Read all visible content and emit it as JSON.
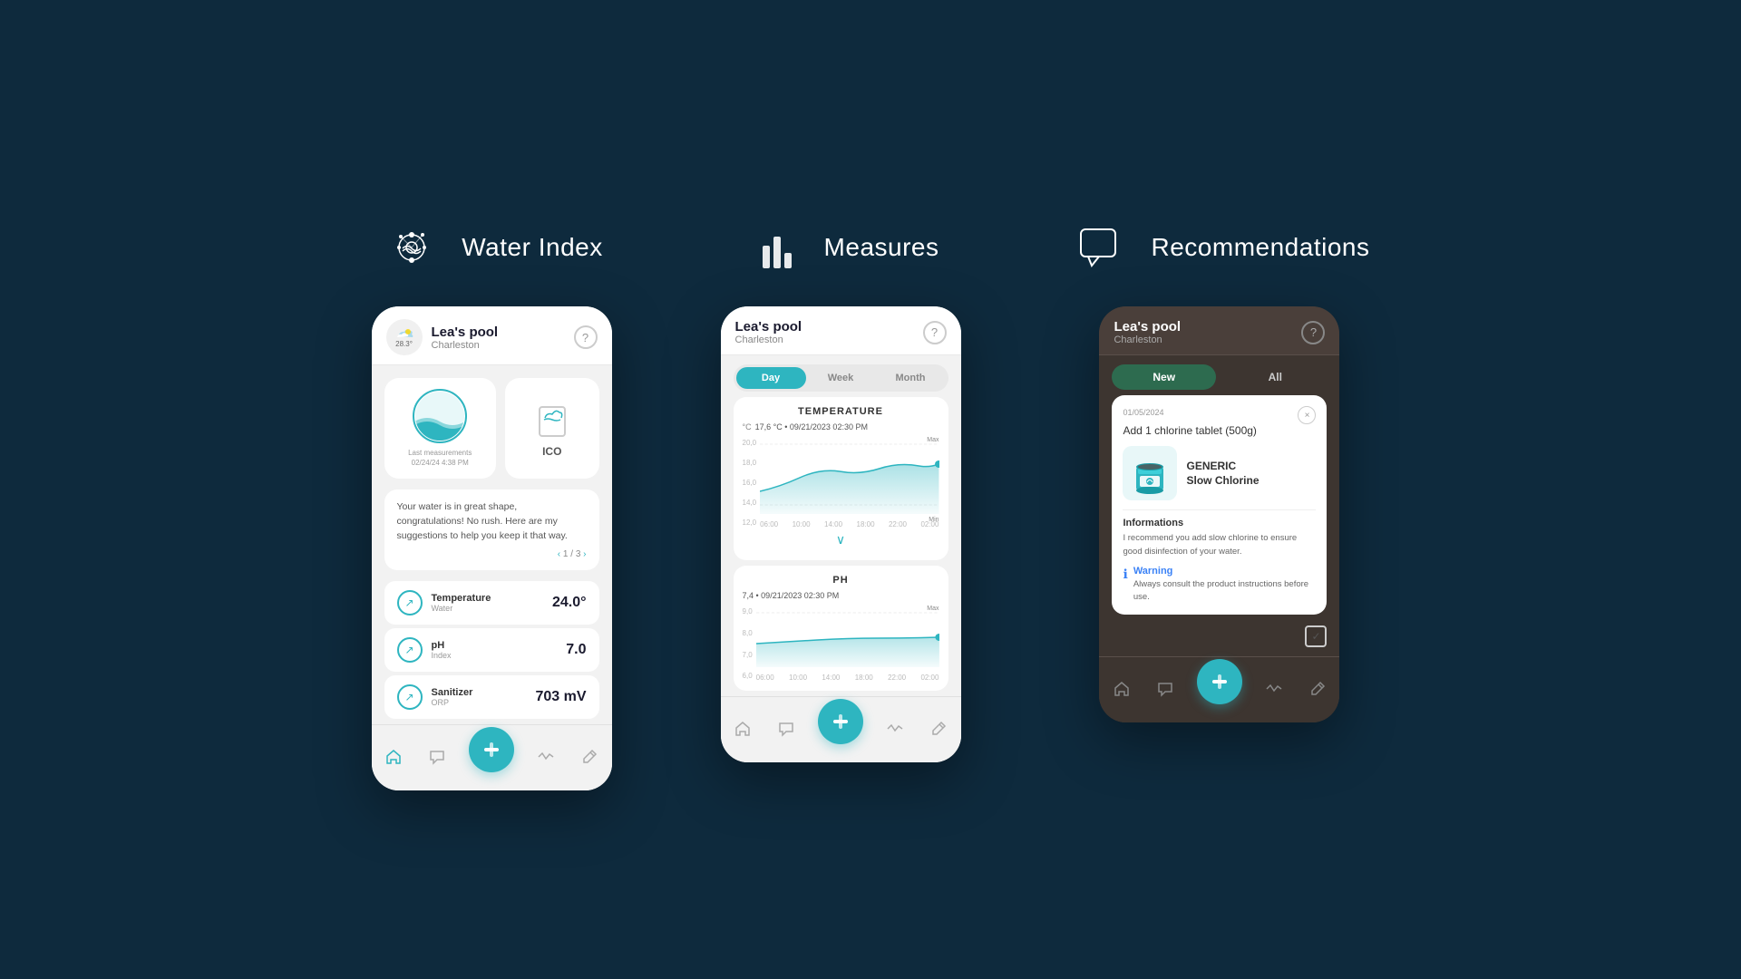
{
  "sections": [
    {
      "id": "water-index",
      "icon": "water-index-icon",
      "title": "Water Index"
    },
    {
      "id": "measures",
      "icon": "measures-icon",
      "title": "Measures"
    },
    {
      "id": "recommendations",
      "icon": "recommendations-icon",
      "title": "Recommendations"
    }
  ],
  "waterIndexPhone": {
    "poolName": "Lea's pool",
    "location": "Charleston",
    "temperature": "28.3°",
    "lastMeasurement": "Last measurements",
    "lastMeasDate": "02/24/24 4:38 PM",
    "icoLabel": "ICO",
    "helpBtn": "?",
    "suggestion": "Your water is in great shape, congratulations! No rush. Here are my suggestions to help you keep it that way.",
    "pagination": "1 / 3",
    "metrics": [
      {
        "name": "Temperature",
        "sub": "Water",
        "value": "24.0°"
      },
      {
        "name": "pH",
        "sub": "Index",
        "value": "7.0"
      },
      {
        "name": "Sanitizer",
        "sub": "ORP",
        "value": "703 mV"
      }
    ],
    "navItems": [
      "home",
      "chat",
      "scan",
      "activity",
      "edit"
    ]
  },
  "measuresPhone": {
    "poolName": "Lea's pool",
    "location": "Charleston",
    "helpBtn": "?",
    "tabs": [
      "Day",
      "Week",
      "Month"
    ],
    "activeTab": "Day",
    "temperature": {
      "title": "TEMPERATURE",
      "subtitle": "°C",
      "value": "17,6 °C",
      "date": "09/21/2023 02:30 PM",
      "maxLabel": "Max",
      "minLabel": "Min",
      "yLabels": [
        "20,0",
        "18,0",
        "16,0",
        "14,0",
        "12,0"
      ],
      "xLabels": [
        "06:00",
        "10:00",
        "14:00",
        "18:00",
        "22:00",
        "02:00"
      ],
      "chartColor": "#2eb5c0"
    },
    "ph": {
      "title": "PH",
      "subtitle": "",
      "value": "7,4",
      "date": "09/21/2023 02:30 PM",
      "maxLabel": "Max",
      "yLabels": [
        "9,0",
        "8,0",
        "7,0",
        "6,0"
      ],
      "xLabels": [
        "06:00",
        "10:00",
        "14:00",
        "18:00",
        "22:00",
        "02:00"
      ],
      "chartColor": "#2eb5c0"
    }
  },
  "recommendationsPhone": {
    "poolName": "Lea's pool",
    "location": "Charleston",
    "helpBtn": "?",
    "tabs": [
      "New",
      "All"
    ],
    "activeTab": "New",
    "card": {
      "date": "01/05/2024",
      "title": "Add 1 chlorine tablet (500g)",
      "product": {
        "name": "GENERIC\nSlow Chlorine"
      },
      "informationsTitle": "Informations",
      "informationsText": "I recommend you add slow chlorine to ensure good disinfection of your water.",
      "warningTitle": "Warning",
      "warningText": "Always consult the product instructions before use."
    }
  },
  "colors": {
    "teal": "#2eb5c0",
    "darkBg": "#0e2a3d",
    "darkPhone": "#3d3530",
    "white": "#ffffff",
    "lightGray": "#f2f2f2"
  }
}
